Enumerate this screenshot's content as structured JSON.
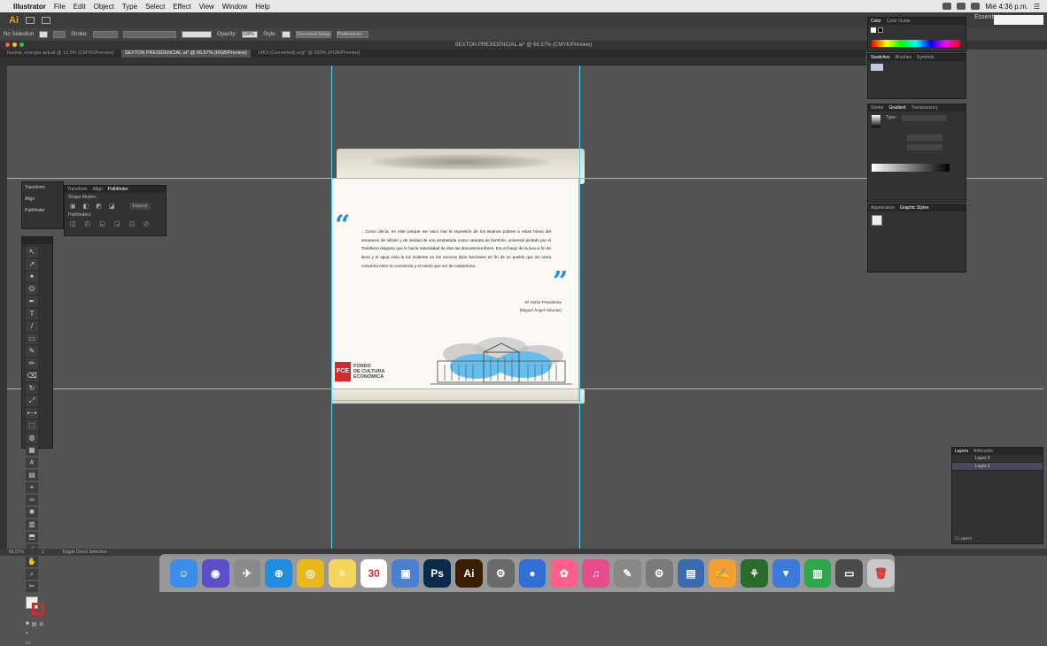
{
  "menubar": {
    "app_name": "Illustrator",
    "items": [
      "File",
      "Edit",
      "Object",
      "Type",
      "Select",
      "Effect",
      "View",
      "Window",
      "Help"
    ],
    "clock": "Mié 4:36 p.m."
  },
  "appbar": {
    "logo": "Ai",
    "workspace": "Essentials"
  },
  "controlbar": {
    "selection": "No Selection",
    "stroke_label": "Stroke:",
    "opacity_label": "Opacity:",
    "opacity_value": "100%",
    "style_label": "Style:",
    "doc_setup": "Document Setup",
    "preferences": "Preferences"
  },
  "doc_title": "SEXTON PRESIDENCIAL.ai* @ 66.57% (CMYK/Preview)",
  "tabs": [
    {
      "label": "Ilustrar, energía actual @ 12.5% (CMYK/Preview)"
    },
    {
      "label": "SEXTON PRESIDENCIAL.ai* @ 66.57% (RGB/Preview)",
      "active": true
    },
    {
      "label": "1453 (Converted).svg* @ 300% (RGB/Preview)"
    }
  ],
  "artboard": {
    "open_quote": "“",
    "close_quote": "”",
    "quote": "…Como decía, en este porque me sacó mal la impresión de los Buenos pobres a estas horas del amanecer de infinito y de deidad de una arrebatada como catarata de bombón, universal pintado por el Todolleno religioso que le hacía naturalidad de dios las discusiones libres. Era el fuego de la luna a fin de liena y el agua vivía la luz evidente en los oscuros dilos lancharse en fin de un pueblo que sin rama convertía entre la conciencia y el miedo que ver de catatortuna…",
    "author_1": "-El Señor Presidente",
    "author_2": "(Miguel Ángel Asturias)",
    "logo_mark": "FCE",
    "logo_line1": "FONDO",
    "logo_line2": "DE CULTURA",
    "logo_line3": "ECONÓMICA"
  },
  "mini_panel": {
    "transform": "Transform",
    "align": "Align",
    "pathfinder": "Pathfinder"
  },
  "pathfinder_panel": {
    "tabs": [
      "Transform",
      "Align",
      "Pathfinder"
    ],
    "shape_modes": "Shape Modes:",
    "pathfinders": "Pathfinders:",
    "expand": "Expand"
  },
  "right_panels": {
    "color_tabs": [
      "Color",
      "Color Guide"
    ],
    "swatch_tabs": [
      "Swatches",
      "Brushes",
      "Symbols"
    ],
    "stroke_tabs": [
      "Stroke",
      "Gradient",
      "Transparency"
    ],
    "gradient_type": "Type:",
    "appearance_tabs": [
      "Appearance",
      "Graphic Styles"
    ]
  },
  "layers": {
    "tabs": [
      "Layers",
      "Artboards"
    ],
    "items": [
      "Layer 2",
      "Layer 1"
    ],
    "count": "2 Layers"
  },
  "status": {
    "zoom": "66.57%",
    "artboard": "1",
    "tool": "Toggle Direct Selection"
  },
  "colors": {
    "accent_blue": "#2b8fd6",
    "fce_red": "#d42a2a",
    "guide": "#4fd6ee"
  },
  "dock": [
    {
      "name": "Finder",
      "color": "#3a8ee8",
      "glyph": "☺"
    },
    {
      "name": "Siri",
      "color": "#5a4fc9",
      "glyph": "◉"
    },
    {
      "name": "Launchpad",
      "color": "#8a8a8a",
      "glyph": "✈"
    },
    {
      "name": "Safari",
      "color": "#1f8de0",
      "glyph": "⊕"
    },
    {
      "name": "Chrome",
      "color": "#e9b91c",
      "glyph": "◎"
    },
    {
      "name": "Notes",
      "color": "#f5d65a",
      "glyph": "≡"
    },
    {
      "name": "Calendar",
      "color": "#ffffff",
      "glyph": "30"
    },
    {
      "name": "Preview",
      "color": "#4a7fd0",
      "glyph": "▣"
    },
    {
      "name": "Photoshop",
      "color": "#0a2a4a",
      "glyph": "Ps"
    },
    {
      "name": "Illustrator",
      "color": "#3a1e00",
      "glyph": "Ai"
    },
    {
      "name": "Preferences",
      "color": "#6a6a6a",
      "glyph": "⚙"
    },
    {
      "name": "App",
      "color": "#2f6fd6",
      "glyph": "●"
    },
    {
      "name": "Photos",
      "color": "#ff5e8a",
      "glyph": "✿"
    },
    {
      "name": "iTunes",
      "color": "#e64c8c",
      "glyph": "♫"
    },
    {
      "name": "Tool",
      "color": "#888888",
      "glyph": "✎"
    },
    {
      "name": "System Preferences",
      "color": "#7a7a7a",
      "glyph": "⚙"
    },
    {
      "name": "Monitor",
      "color": "#3a6ab0",
      "glyph": "▤"
    },
    {
      "name": "Pages",
      "color": "#f0a030",
      "glyph": "✍"
    },
    {
      "name": "App Lime",
      "color": "#2a6a2a",
      "glyph": "⚘"
    },
    {
      "name": "Keynote",
      "color": "#3a7ad8",
      "glyph": "▼"
    },
    {
      "name": "Numbers",
      "color": "#2ea84a",
      "glyph": "▥"
    },
    {
      "name": "Printer",
      "color": "#4a4a4a",
      "glyph": "▭"
    },
    {
      "name": "Trash",
      "color": "#c8c8c8",
      "glyph": "🗑"
    }
  ]
}
